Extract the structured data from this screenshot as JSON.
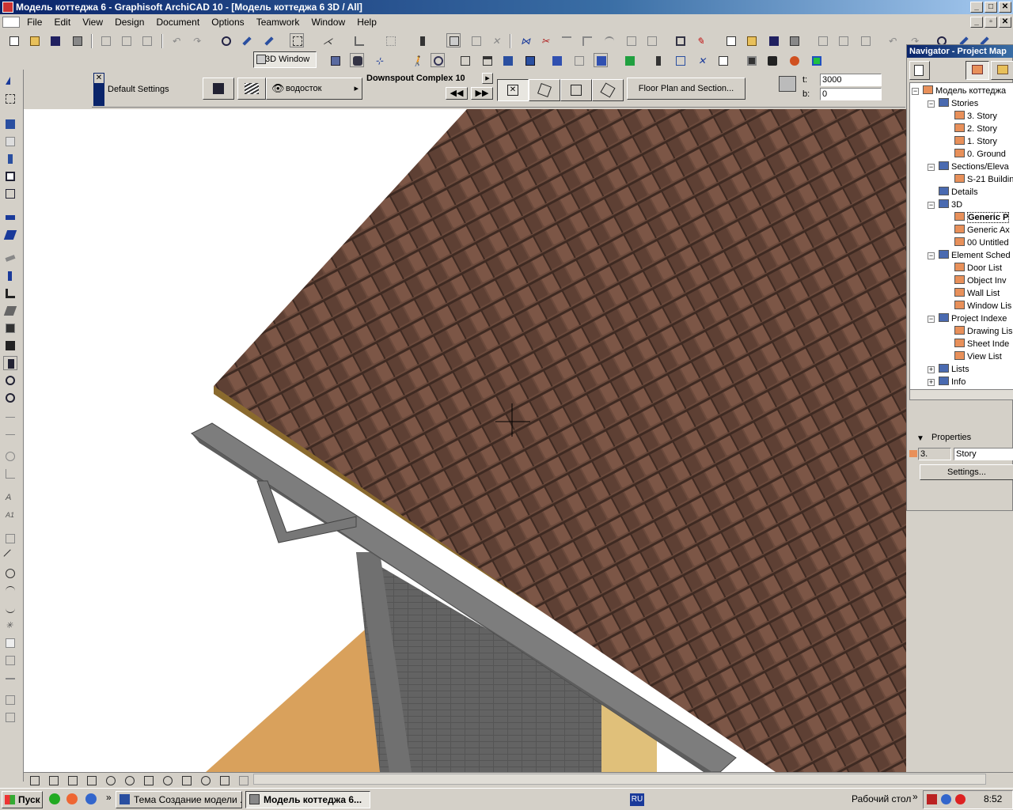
{
  "window": {
    "title": "Модель коттеджа 6 - Graphisoft ArchiCAD 10 - [Модель коттеджа 6 3D / All]"
  },
  "menu": [
    "File",
    "Edit",
    "View",
    "Design",
    "Document",
    "Options",
    "Teamwork",
    "Window",
    "Help"
  ],
  "toolbar2": {
    "view_label": "3D Window"
  },
  "infobox": {
    "settings_label": "Default Settings",
    "layer_label": "водосток",
    "object_name": "Downspout Complex 10",
    "floorplan_button": "Floor Plan and Section...",
    "t_label": "t:",
    "t_value": "3000",
    "b_label": "b:",
    "b_value": "0"
  },
  "navigator": {
    "title": "Navigator - Project Map",
    "tree": [
      {
        "label": "Модель коттеджа",
        "level": 0,
        "pm": "−"
      },
      {
        "label": "Stories",
        "level": 1,
        "pm": "−"
      },
      {
        "label": "3. Story",
        "level": 2
      },
      {
        "label": "2. Story",
        "level": 2
      },
      {
        "label": "1. Story",
        "level": 2
      },
      {
        "label": "0. Ground",
        "level": 2
      },
      {
        "label": "Sections/Eleva",
        "level": 1,
        "pm": "−"
      },
      {
        "label": "S-21 Buildin",
        "level": 2
      },
      {
        "label": "Details",
        "level": 1
      },
      {
        "label": "3D",
        "level": 1,
        "pm": "−"
      },
      {
        "label": "Generic P",
        "level": 2,
        "selected": true
      },
      {
        "label": "Generic Ax",
        "level": 2
      },
      {
        "label": "00 Untitled",
        "level": 2
      },
      {
        "label": "Element Sched",
        "level": 1,
        "pm": "−"
      },
      {
        "label": "Door List",
        "level": 2
      },
      {
        "label": "Object Inv",
        "level": 2
      },
      {
        "label": "Wall List",
        "level": 2
      },
      {
        "label": "Window Lis",
        "level": 2
      },
      {
        "label": "Project Indexe",
        "level": 1,
        "pm": "−"
      },
      {
        "label": "Drawing Lis",
        "level": 2
      },
      {
        "label": "Sheet Inde",
        "level": 2
      },
      {
        "label": "View List",
        "level": 2
      },
      {
        "label": "Lists",
        "level": 1,
        "pm": "+"
      },
      {
        "label": "Info",
        "level": 1,
        "pm": "+"
      }
    ],
    "properties_label": "Properties",
    "prop_id": "3.",
    "prop_name": "Story",
    "settings_button": "Settings..."
  },
  "taskbar": {
    "start_label": "Пуск",
    "tasks": [
      "Тема Создание модели ...",
      "Модель коттеджа 6..."
    ],
    "lang": "RU",
    "desktop_label": "Рабочий стол",
    "clock": "8:52"
  },
  "colors": {
    "title_bar": "#0a246a",
    "roof_tiles": "#6b4a3c",
    "fascia": "#8a6a2e",
    "gutter": "#7d7d7d",
    "wall": "#5e5e5e",
    "floor": "#d9a15c"
  }
}
